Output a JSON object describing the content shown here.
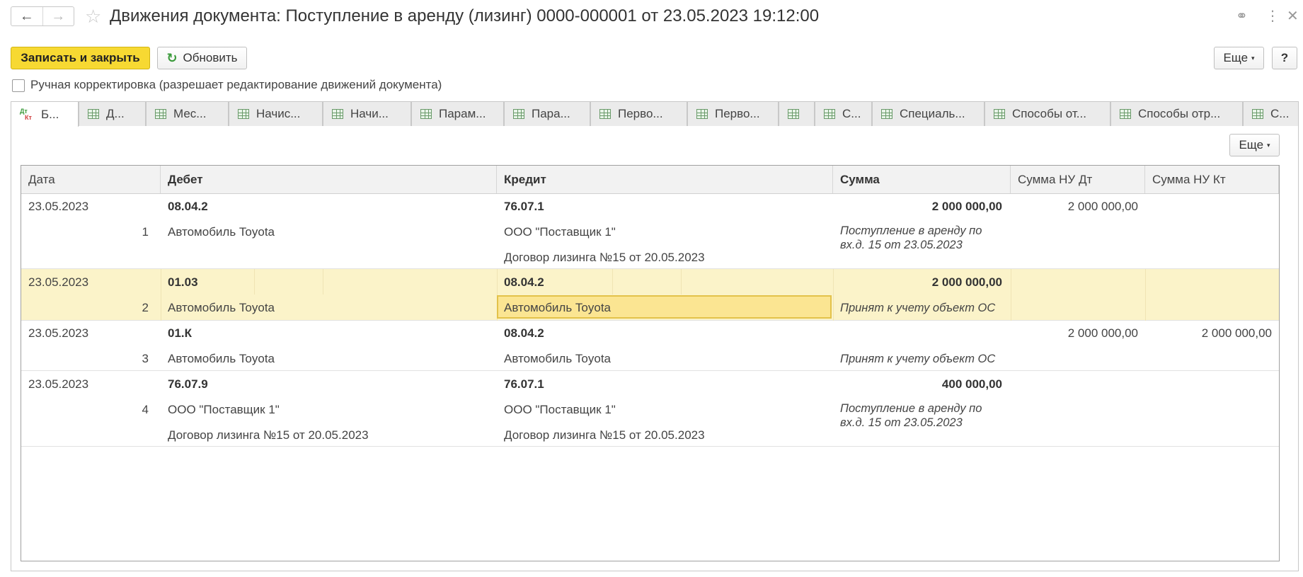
{
  "window": {
    "title": "Движения документа: Поступление в аренду (лизинг) 0000-000001 от 23.05.2023 19:12:00",
    "back_icon": "←",
    "forward_icon": "→",
    "star_icon": "☆",
    "link_icon": "⚭",
    "more_icon": "⋮",
    "close_icon": "✕"
  },
  "toolbar": {
    "save_close_label": "Записать и закрыть",
    "refresh_label": "Обновить",
    "refresh_icon": "↻",
    "more_label": "Еще",
    "help_label": "?",
    "manual_label": "Ручная корректировка (разрешает редактирование движений документа)"
  },
  "tabs": [
    {
      "label": "Б..."
    },
    {
      "label": "Д..."
    },
    {
      "label": "Мес..."
    },
    {
      "label": "Начис..."
    },
    {
      "label": "Начи..."
    },
    {
      "label": "Парам..."
    },
    {
      "label": "Пара..."
    },
    {
      "label": "Перво..."
    },
    {
      "label": "Перво..."
    },
    {
      "label": ""
    },
    {
      "label": "С..."
    },
    {
      "label": "Специаль..."
    },
    {
      "label": "Способы от..."
    },
    {
      "label": "Способы отр..."
    },
    {
      "label": "С..."
    }
  ],
  "tab_icon_dt": "Дт",
  "tab_icon_kt": "Кт",
  "panel_more_label": "Еще",
  "columns": [
    "Дата",
    "Дебет",
    "Кредит",
    "Сумма",
    "Сумма НУ Дт",
    "Сумма НУ Кт"
  ],
  "rows": [
    {
      "date": "23.05.2023",
      "num": "1",
      "debit_account": "08.04.2",
      "debit_sub1": "Автомобиль Toyota",
      "debit_sub2": "",
      "credit_account": "76.07.1",
      "credit_sub1": "ООО \"Поставщик 1\"",
      "credit_sub2": "Договор лизинга №15 от 20.05.2023",
      "sum": "2 000 000,00",
      "content": "Поступление в аренду по вх.д. 15 от 23.05.2023",
      "nu_dt": "2 000 000,00",
      "nu_kt": ""
    },
    {
      "date": "23.05.2023",
      "num": "2",
      "debit_account": "01.03",
      "debit_sub1": "Автомобиль Toyota",
      "debit_sub2": "",
      "credit_account": "08.04.2",
      "credit_sub1": "Автомобиль Toyota",
      "credit_sub2": "",
      "sum": "2 000 000,00",
      "content": "Принят к учету объект ОС",
      "nu_dt": "",
      "nu_kt": ""
    },
    {
      "date": "23.05.2023",
      "num": "3",
      "debit_account": "01.К",
      "debit_sub1": "Автомобиль Toyota",
      "debit_sub2": "",
      "credit_account": "08.04.2",
      "credit_sub1": "Автомобиль Toyota",
      "credit_sub2": "",
      "sum": "",
      "content": "Принят к учету объект ОС",
      "nu_dt": "2 000 000,00",
      "nu_kt": "2 000 000,00"
    },
    {
      "date": "23.05.2023",
      "num": "4",
      "debit_account": "76.07.9",
      "debit_sub1": "ООО \"Поставщик 1\"",
      "debit_sub2": "Договор лизинга №15 от 20.05.2023",
      "credit_account": "76.07.1",
      "credit_sub1": "ООО \"Поставщик 1\"",
      "credit_sub2": "Договор лизинга №15 от 20.05.2023",
      "sum": "400 000,00",
      "content": "Поступление в аренду по вх.д. 15 от 23.05.2023",
      "nu_dt": "",
      "nu_kt": ""
    }
  ],
  "colors": {
    "primary_button": "#f7d932",
    "selected_row": "#fbf3c9",
    "selected_cell": "#fbe592"
  }
}
